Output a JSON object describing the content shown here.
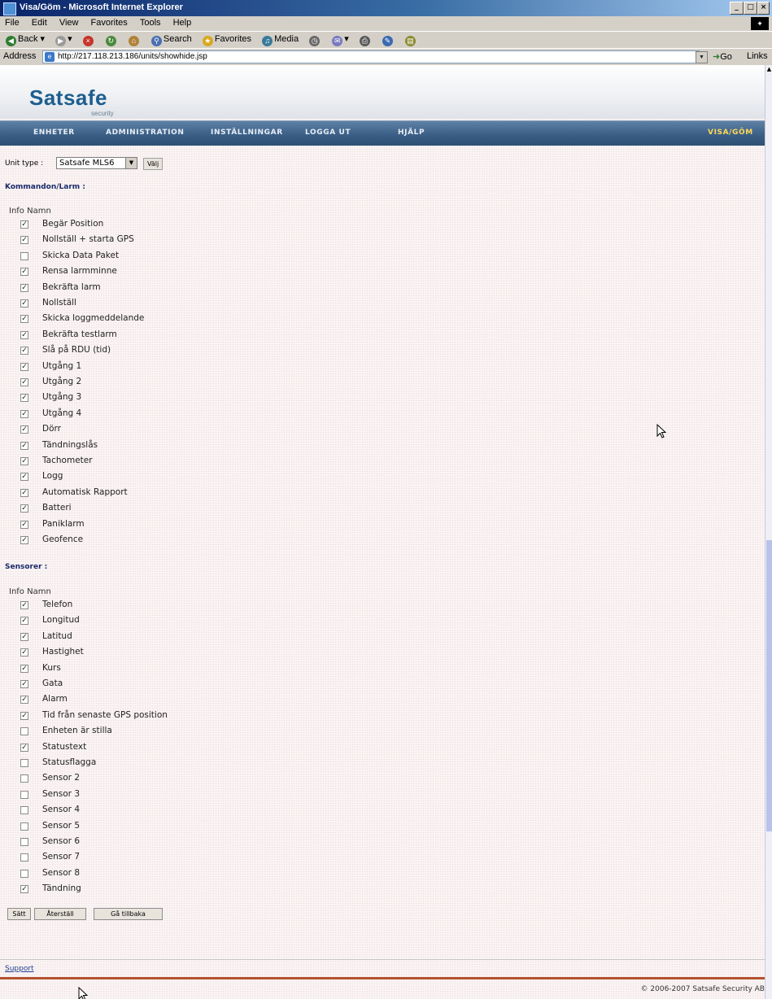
{
  "window": {
    "title": "Visa/Göm - Microsoft Internet Explorer"
  },
  "menubar": {
    "items": [
      "File",
      "Edit",
      "View",
      "Favorites",
      "Tools",
      "Help"
    ]
  },
  "toolbar": {
    "back": "Back",
    "search": "Search",
    "favorites": "Favorites",
    "media": "Media"
  },
  "addressbar": {
    "label": "Address",
    "url": "http://217.118.213.186/units/showhide.jsp",
    "go": "Go",
    "links": "Links"
  },
  "brand": {
    "name": "Satsafe",
    "tagline": "security"
  },
  "nav": {
    "items": [
      "ENHETER",
      "ADMINISTRATION",
      "INSTÄLLNINGAR",
      "LOGGA UT",
      "HJÄLP"
    ],
    "active": "VISA/GÖM"
  },
  "unit": {
    "label": "Unit type :",
    "selected": "Satsafe MLS6",
    "button": "Välj"
  },
  "commands": {
    "title": "Kommandon/Larm :",
    "header": "Info Namn",
    "items": [
      {
        "label": "Begär Position",
        "checked": true
      },
      {
        "label": "Nollställ + starta GPS",
        "checked": true
      },
      {
        "label": "Skicka Data Paket",
        "checked": false
      },
      {
        "label": "Rensa larmminne",
        "checked": true
      },
      {
        "label": "Bekräfta larm",
        "checked": true
      },
      {
        "label": "Nollställ",
        "checked": true
      },
      {
        "label": "Skicka loggmeddelande",
        "checked": true
      },
      {
        "label": "Bekräfta testlarm",
        "checked": true
      },
      {
        "label": "Slå på RDU (tid)",
        "checked": true
      },
      {
        "label": "Utgång 1",
        "checked": true
      },
      {
        "label": "Utgång 2",
        "checked": true
      },
      {
        "label": "Utgång 3",
        "checked": true
      },
      {
        "label": "Utgång 4",
        "checked": true
      },
      {
        "label": "Dörr",
        "checked": true
      },
      {
        "label": "Tändningslås",
        "checked": true
      },
      {
        "label": "Tachometer",
        "checked": true
      },
      {
        "label": "Logg",
        "checked": true
      },
      {
        "label": "Automatisk Rapport",
        "checked": true
      },
      {
        "label": "Batteri",
        "checked": true
      },
      {
        "label": "Paniklarm",
        "checked": true
      },
      {
        "label": "Geofence",
        "checked": true
      }
    ]
  },
  "sensors": {
    "title": "Sensorer :",
    "header": "Info Namn",
    "items": [
      {
        "label": "Telefon",
        "checked": true
      },
      {
        "label": "Longitud",
        "checked": true
      },
      {
        "label": "Latitud",
        "checked": true
      },
      {
        "label": "Hastighet",
        "checked": true
      },
      {
        "label": "Kurs",
        "checked": true
      },
      {
        "label": "Gata",
        "checked": true
      },
      {
        "label": "Alarm",
        "checked": true
      },
      {
        "label": "Tid från senaste GPS position",
        "checked": true
      },
      {
        "label": "Enheten är stilla",
        "checked": false
      },
      {
        "label": "Statustext",
        "checked": true
      },
      {
        "label": "Statusflagga",
        "checked": false
      },
      {
        "label": "Sensor 2",
        "checked": false
      },
      {
        "label": "Sensor 3",
        "checked": false
      },
      {
        "label": "Sensor 4",
        "checked": false
      },
      {
        "label": "Sensor 5",
        "checked": false
      },
      {
        "label": "Sensor 6",
        "checked": false
      },
      {
        "label": "Sensor 7",
        "checked": false
      },
      {
        "label": "Sensor 8",
        "checked": false
      },
      {
        "label": "Tändning",
        "checked": true
      }
    ]
  },
  "actions": {
    "set": "Sätt",
    "reset": "Återställ",
    "back": "Gå tillbaka"
  },
  "footer": {
    "support": "Support",
    "copyright": "© 2006-2007 Satsafe Security AB"
  },
  "colors": {
    "nav_bg": "#3b5f86",
    "nav_active": "#ffd957",
    "section_title": "#1a2a6b",
    "footer_band": "#b4522f"
  }
}
